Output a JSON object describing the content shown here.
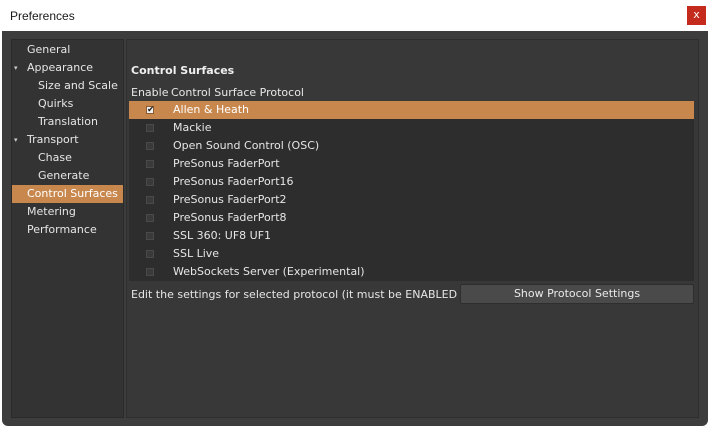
{
  "window": {
    "title": "Preferences",
    "close_symbol": "x"
  },
  "sidebar": {
    "items": [
      {
        "label": "General"
      },
      {
        "label": "Appearance",
        "expanded": true
      },
      {
        "label": "Size and Scale"
      },
      {
        "label": "Quirks"
      },
      {
        "label": "Translation"
      },
      {
        "label": "Transport",
        "expanded": true
      },
      {
        "label": "Chase"
      },
      {
        "label": "Generate"
      },
      {
        "label": "Control Surfaces",
        "selected": true
      },
      {
        "label": "Metering"
      },
      {
        "label": "Performance"
      }
    ],
    "expander_symbol": "▾"
  },
  "main": {
    "section_title": "Control Surfaces",
    "columns": {
      "enable": "Enable",
      "protocol": "Control Surface Protocol"
    },
    "protocols": [
      {
        "name": "Allen & Heath",
        "enabled": true,
        "selected": true
      },
      {
        "name": "Mackie",
        "enabled": false
      },
      {
        "name": "Open Sound Control (OSC)",
        "enabled": false
      },
      {
        "name": "PreSonus FaderPort",
        "enabled": false
      },
      {
        "name": "PreSonus FaderPort16",
        "enabled": false
      },
      {
        "name": "PreSonus FaderPort2",
        "enabled": false
      },
      {
        "name": "PreSonus FaderPort8",
        "enabled": false
      },
      {
        "name": "SSL 360: UF8 UF1",
        "enabled": false
      },
      {
        "name": "SSL Live",
        "enabled": false
      },
      {
        "name": "WebSockets Server (Experimental)",
        "enabled": false
      }
    ],
    "hint": "Edit the settings for selected protocol (it must be ENABLED first):",
    "show_settings_label": "Show Protocol Settings",
    "check_symbol": "✔"
  },
  "colors": {
    "accent": "#c8874d",
    "background": "#3d3d3d",
    "list_bg": "#2d2d2d",
    "close": "#c42b1c"
  }
}
